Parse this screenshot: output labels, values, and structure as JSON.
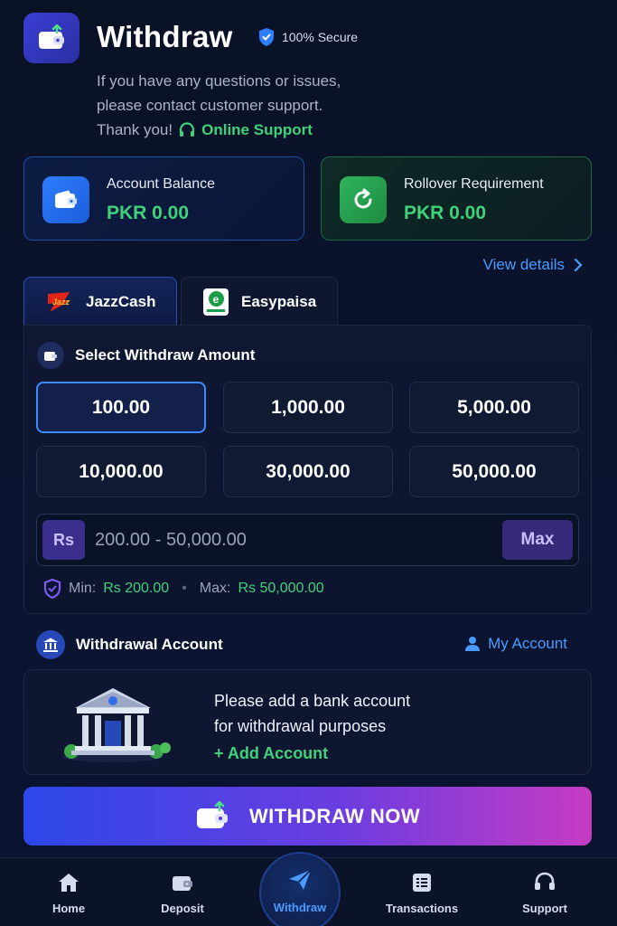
{
  "header": {
    "title": "Withdraw",
    "secure_label": "100% Secure",
    "message_line1": "If you have any questions or issues,",
    "message_line2": "please contact customer support.",
    "message_line3": "Thank you!",
    "support_link": "Online Support"
  },
  "balance_card": {
    "label": "Account Balance",
    "value": "PKR 0.00",
    "icon": "wallet-icon"
  },
  "rollover_card": {
    "label": "Rollover Requirement",
    "value": "PKR 0.00",
    "icon": "refresh-icon"
  },
  "view_details": "View details",
  "payment_tabs": [
    {
      "label": "JazzCash",
      "active": true,
      "logo_text": "Jazz"
    },
    {
      "label": "Easypaisa",
      "active": false,
      "logo_text": "e"
    }
  ],
  "amount_section": {
    "title": "Select Withdraw Amount",
    "amounts": [
      "100.00",
      "1,000.00",
      "5,000.00",
      "10,000.00",
      "30,000.00",
      "50,000.00"
    ],
    "selected_index": 0,
    "currency_badge": "Rs",
    "input_placeholder": "200.00 - 50,000.00",
    "max_button": "Max",
    "min_label": "Min:",
    "min_value": "Rs 200.00",
    "max_label": "Max:",
    "max_value": "Rs 50,000.00"
  },
  "withdrawal_account": {
    "title": "Withdrawal Account",
    "my_account": "My Account",
    "empty_line1": "Please add a bank account",
    "empty_line2": "for withdrawal purposes",
    "add_account": "+ Add Account"
  },
  "withdraw_button": "WITHDRAW NOW",
  "bottom_nav": [
    {
      "label": "Home",
      "icon": "home-icon"
    },
    {
      "label": "Deposit",
      "icon": "wallet-icon"
    },
    {
      "label": "Withdraw",
      "icon": "send-icon",
      "active": true
    },
    {
      "label": "Transactions",
      "icon": "list-icon"
    },
    {
      "label": "Support",
      "icon": "headset-icon"
    }
  ],
  "colors": {
    "accent_blue": "#4a9bff",
    "accent_green": "#3fd27a",
    "background": "#0a1226"
  }
}
